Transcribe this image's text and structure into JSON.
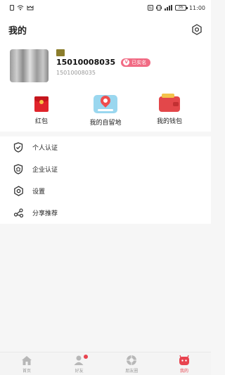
{
  "status_bar": {
    "time": "11:00",
    "battery": "36",
    "icons": [
      "sim-icon",
      "wifi-icon",
      "nfc-icon",
      "vibrate-icon",
      "signal-icon",
      "battery-icon"
    ]
  },
  "header": {
    "title": "我的",
    "settings_icon": "hexagon-settings-icon"
  },
  "profile": {
    "username": "15010008035",
    "user_id": "15010008035",
    "verified_label": "已实名",
    "verified_mark": "V"
  },
  "quick_actions": [
    {
      "label": "红包",
      "icon": "red-envelope-icon"
    },
    {
      "label": "我的自留地",
      "icon": "location-pin-icon"
    },
    {
      "label": "我的钱包",
      "icon": "wallet-icon"
    }
  ],
  "menu": [
    {
      "label": "个人认证",
      "icon": "shield-check-icon"
    },
    {
      "label": "企业认证",
      "icon": "enterprise-shield-icon"
    },
    {
      "label": "设置",
      "icon": "hexagon-gear-icon"
    },
    {
      "label": "分享推荐",
      "icon": "share-icon"
    }
  ],
  "tabs": [
    {
      "label": "首页",
      "icon": "home-icon"
    },
    {
      "label": "好友",
      "icon": "friends-icon"
    },
    {
      "label": "朋友圈",
      "icon": "moments-icon"
    },
    {
      "label": "我的",
      "icon": "profile-icon"
    }
  ],
  "colors": {
    "accent": "#e8434f",
    "badge": "#f16b84",
    "red": "#e0242b",
    "inactive_tab": "#999999"
  }
}
